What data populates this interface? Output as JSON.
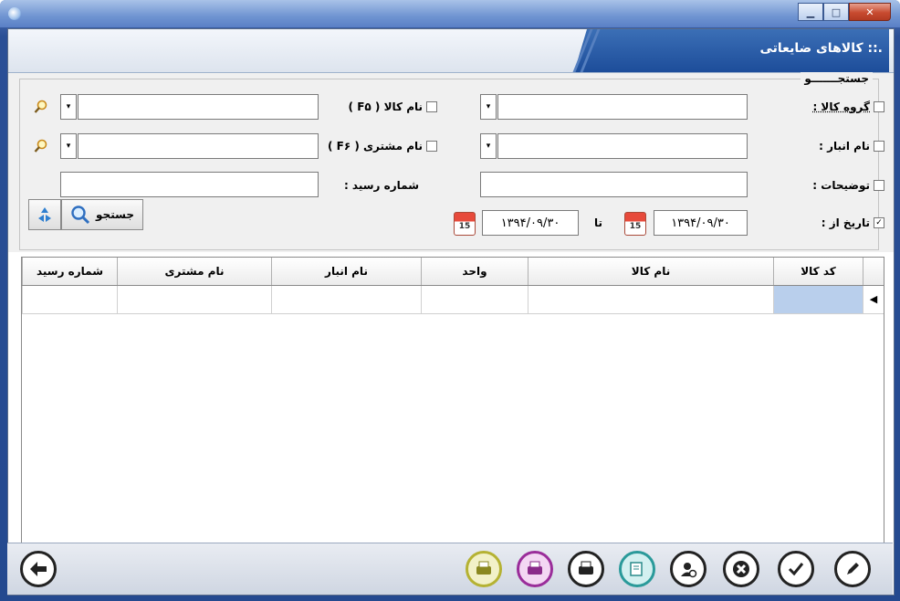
{
  "window": {
    "title_visible": "",
    "controls": [
      "minimize",
      "maximize",
      "close"
    ]
  },
  "header": {
    "title": ".:: کالاهای ضایعاتی"
  },
  "search": {
    "legend": "جستجـــــــو",
    "fields": {
      "kala_group_label": "گروه کالا :",
      "kala_name_label": "نام کالا ( F۵ )",
      "anbar_label": "نام انبار :",
      "customer_label": "نام مشتری ( F۶ )",
      "notes_label": "توضیحات :",
      "receipt_label": "شماره رسید :",
      "date_from_label": "تاریخ از :",
      "date_to_label": "تا",
      "date_from": "۱۳۹۴/۰۹/۳۰",
      "date_to": "۱۳۹۴/۰۹/۳۰",
      "calendar_day": "15"
    },
    "search_button": "جستجو"
  },
  "grid": {
    "columns": [
      "کد کالا",
      "نام کالا",
      "واحد",
      "نام انبار",
      "نام مشتری",
      "شماره رسید"
    ]
  },
  "colors": {
    "titlebar": "#6f94d1",
    "header_stripe": "#1d4d9a",
    "selected_cell": "#b9cfec"
  }
}
